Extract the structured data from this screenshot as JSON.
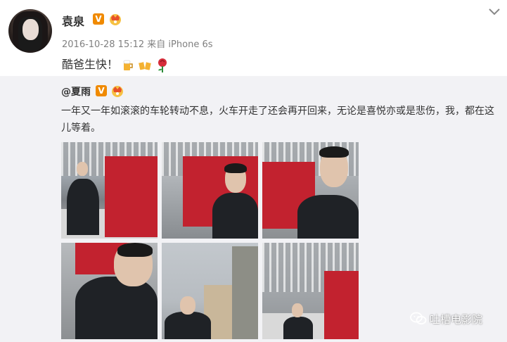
{
  "post": {
    "username": "袁泉",
    "verified_badge": "V",
    "timestamp": "2016-10-28 15:12",
    "source": "来自 iPhone 6s",
    "text": "酷爸生快！",
    "emoji_icons": [
      "beer-icon",
      "cheers-icon",
      "rose-icon"
    ]
  },
  "repost": {
    "mention": "@夏雨",
    "verified_badge": "V",
    "text": "一年又一年如滚滚的车轮转动不息，火车开走了还会再开回来，无论是喜悦亦或是悲伤，我，都在这儿等着。",
    "photo_count": 6
  },
  "watermark": {
    "text": "吐槽电影院"
  },
  "colors": {
    "verified": "#f08a00",
    "train_red": "#c2222f",
    "repost_bg": "#f2f2f5"
  }
}
